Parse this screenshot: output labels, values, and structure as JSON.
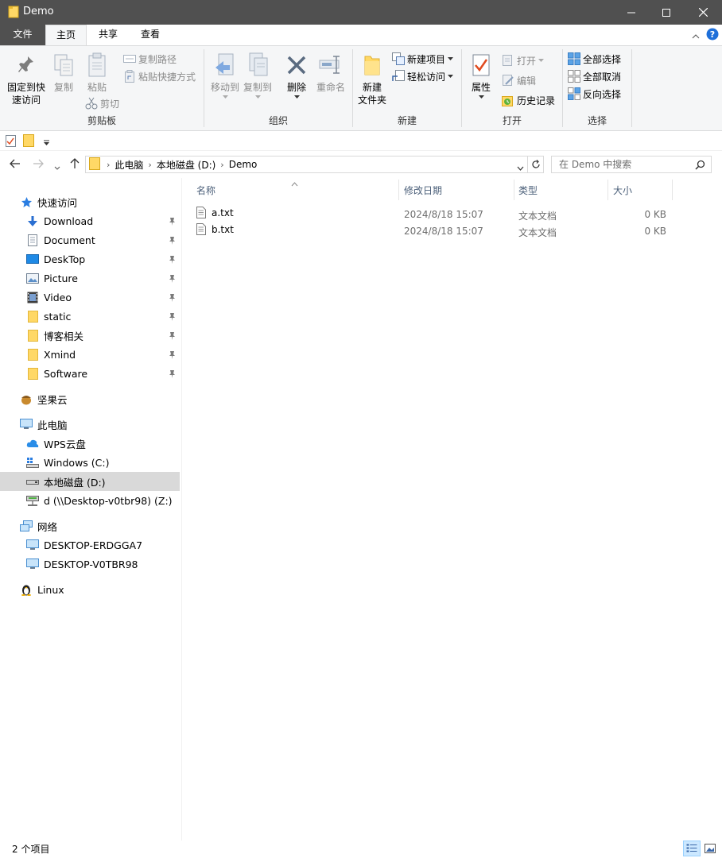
{
  "window": {
    "title": "Demo"
  },
  "tabs": [
    {
      "label": "文件"
    },
    {
      "label": "主页"
    },
    {
      "label": "共享"
    },
    {
      "label": "查看"
    }
  ],
  "ribbon": {
    "clipboard": {
      "group_label": "剪贴板",
      "pin_quick_access": "固定到快\n速访问",
      "pin_line1": "固定到快",
      "pin_line2": "速访问",
      "copy": "复制",
      "paste": "粘贴",
      "copy_path": "复制路径",
      "paste_shortcut": "粘贴快捷方式",
      "cut": "剪切"
    },
    "organize": {
      "group_label": "组织",
      "move_to": "移动到",
      "copy_to": "复制到",
      "delete": "删除",
      "rename": "重命名"
    },
    "new": {
      "group_label": "新建",
      "new_folder_line1": "新建",
      "new_folder_line2": "文件夹",
      "new_item": "新建项目",
      "easy_access": "轻松访问"
    },
    "open": {
      "group_label": "打开",
      "properties": "属性",
      "open": "打开",
      "edit": "编辑",
      "history": "历史记录"
    },
    "select": {
      "group_label": "选择",
      "select_all": "全部选择",
      "select_none": "全部取消",
      "invert": "反向选择"
    }
  },
  "address": {
    "crumbs": [
      "此电脑",
      "本地磁盘 (D:)",
      "Demo"
    ]
  },
  "search": {
    "placeholder": "在 Demo 中搜索"
  },
  "sidebar": {
    "quick_access": "快速访问",
    "quick_items": [
      {
        "label": "Download"
      },
      {
        "label": "Document"
      },
      {
        "label": "DeskTop"
      },
      {
        "label": "Picture"
      },
      {
        "label": "Video"
      },
      {
        "label": "static"
      },
      {
        "label": "博客相关"
      },
      {
        "label": "Xmind"
      },
      {
        "label": "Software"
      }
    ],
    "jianguoyun": "坚果云",
    "this_pc": "此电脑",
    "pc_items": [
      {
        "label": "WPS云盘"
      },
      {
        "label": "Windows (C:)"
      },
      {
        "label": "本地磁盘 (D:)"
      },
      {
        "label": "d (\\\\Desktop-v0tbr98) (Z:)"
      }
    ],
    "network": "网络",
    "network_items": [
      {
        "label": "DESKTOP-ERDGGA7"
      },
      {
        "label": "DESKTOP-V0TBR98"
      }
    ],
    "linux": "Linux"
  },
  "columns": {
    "name": "名称",
    "date": "修改日期",
    "type": "类型",
    "size": "大小"
  },
  "files": [
    {
      "name": "a.txt",
      "date": "2024/8/18 15:07",
      "type": "文本文档",
      "size": "0 KB"
    },
    {
      "name": "b.txt",
      "date": "2024/8/18 15:07",
      "type": "文本文档",
      "size": "0 KB"
    }
  ],
  "status": {
    "count": "2 个项目"
  },
  "colors": {
    "folder": "#ffd866",
    "titlebar": "#505050",
    "accent": "#0078d7",
    "selected": "#d9d9d9"
  }
}
